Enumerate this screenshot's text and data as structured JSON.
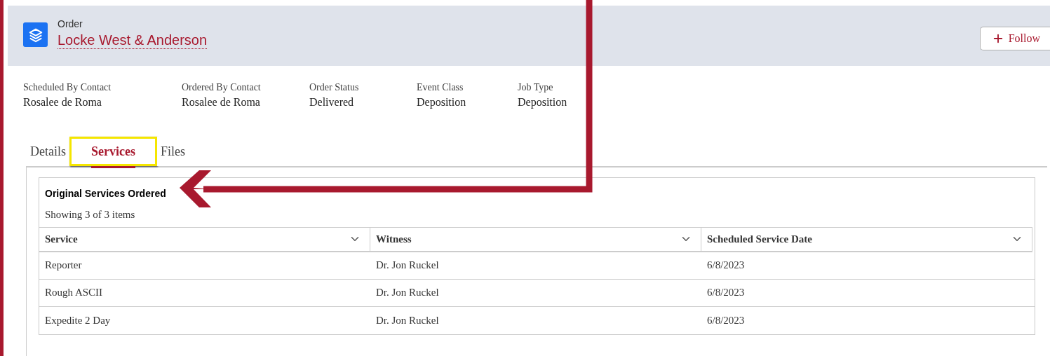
{
  "header": {
    "object_type": "Order",
    "title": "Locke West & Anderson",
    "follow_label": "Follow"
  },
  "fields": [
    {
      "label": "Scheduled By Contact",
      "value": "Rosalee de Roma"
    },
    {
      "label": "Ordered By Contact",
      "value": "Rosalee de Roma"
    },
    {
      "label": "Order Status",
      "value": "Delivered"
    },
    {
      "label": "Event Class",
      "value": "Deposition"
    },
    {
      "label": "Job Type",
      "value": "Deposition"
    }
  ],
  "tabs": [
    {
      "label": "Details",
      "selected": false,
      "highlighted": false
    },
    {
      "label": "Services",
      "selected": true,
      "highlighted": true
    },
    {
      "label": "Files",
      "selected": false,
      "highlighted": false
    }
  ],
  "services_table": {
    "title": "Original Services Ordered",
    "count": "Showing 3 of 3 items",
    "columns": [
      "Service",
      "Witness",
      "Scheduled Service Date"
    ],
    "rows": [
      [
        "Reporter",
        "Dr. Jon Ruckel",
        "6/8/2023"
      ],
      [
        "Rough ASCII",
        "Dr. Jon Ruckel",
        "6/8/2023"
      ],
      [
        "Expedite 2 Day",
        "Dr. Jon Ruckel",
        "6/8/2023"
      ]
    ]
  }
}
